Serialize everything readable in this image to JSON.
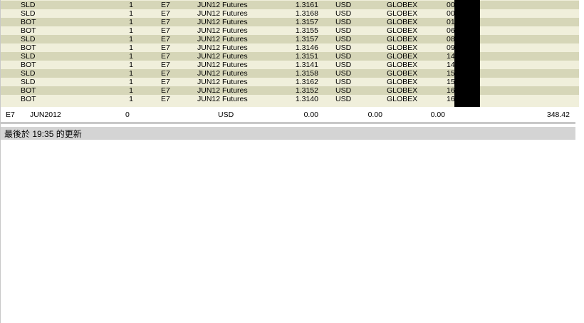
{
  "trades": [
    {
      "action": "SLD",
      "qty": "1",
      "symbol": "E7",
      "description": "JUN12 Futures",
      "price": "1.3161",
      "currency": "USD",
      "exchange": "GLOBEX",
      "time": "00"
    },
    {
      "action": "SLD",
      "qty": "1",
      "symbol": "E7",
      "description": "JUN12 Futures",
      "price": "1.3168",
      "currency": "USD",
      "exchange": "GLOBEX",
      "time": "00"
    },
    {
      "action": "BOT",
      "qty": "1",
      "symbol": "E7",
      "description": "JUN12 Futures",
      "price": "1.3157",
      "currency": "USD",
      "exchange": "GLOBEX",
      "time": "01"
    },
    {
      "action": "BOT",
      "qty": "1",
      "symbol": "E7",
      "description": "JUN12 Futures",
      "price": "1.3155",
      "currency": "USD",
      "exchange": "GLOBEX",
      "time": "06"
    },
    {
      "action": "SLD",
      "qty": "1",
      "symbol": "E7",
      "description": "JUN12 Futures",
      "price": "1.3157",
      "currency": "USD",
      "exchange": "GLOBEX",
      "time": "08"
    },
    {
      "action": "BOT",
      "qty": "1",
      "symbol": "E7",
      "description": "JUN12 Futures",
      "price": "1.3146",
      "currency": "USD",
      "exchange": "GLOBEX",
      "time": "09"
    },
    {
      "action": "SLD",
      "qty": "1",
      "symbol": "E7",
      "description": "JUN12 Futures",
      "price": "1.3151",
      "currency": "USD",
      "exchange": "GLOBEX",
      "time": "14"
    },
    {
      "action": "BOT",
      "qty": "1",
      "symbol": "E7",
      "description": "JUN12 Futures",
      "price": "1.3141",
      "currency": "USD",
      "exchange": "GLOBEX",
      "time": "14"
    },
    {
      "action": "SLD",
      "qty": "1",
      "symbol": "E7",
      "description": "JUN12 Futures",
      "price": "1.3158",
      "currency": "USD",
      "exchange": "GLOBEX",
      "time": "15"
    },
    {
      "action": "SLD",
      "qty": "1",
      "symbol": "E7",
      "description": "JUN12 Futures",
      "price": "1.3162",
      "currency": "USD",
      "exchange": "GLOBEX",
      "time": "15"
    },
    {
      "action": "BOT",
      "qty": "1",
      "symbol": "E7",
      "description": "JUN12 Futures",
      "price": "1.3152",
      "currency": "USD",
      "exchange": "GLOBEX",
      "time": "16"
    },
    {
      "action": "BOT",
      "qty": "1",
      "symbol": "E7",
      "description": "JUN12 Futures",
      "price": "1.3140",
      "currency": "USD",
      "exchange": "GLOBEX",
      "time": "16"
    }
  ],
  "summary": {
    "symbol": "E7",
    "month": "JUN2012",
    "position": "0",
    "currency": "USD",
    "value1": "0.00",
    "value2": "0.00",
    "value3": "0.00",
    "value4": "348.42"
  },
  "status": {
    "last_updated": "最後於 19:35 的更新"
  },
  "colors": {
    "row_dark": "#d6d6b8",
    "row_light": "#f0efdb",
    "status_bar": "#d4d4d4",
    "redaction": "#000000"
  }
}
